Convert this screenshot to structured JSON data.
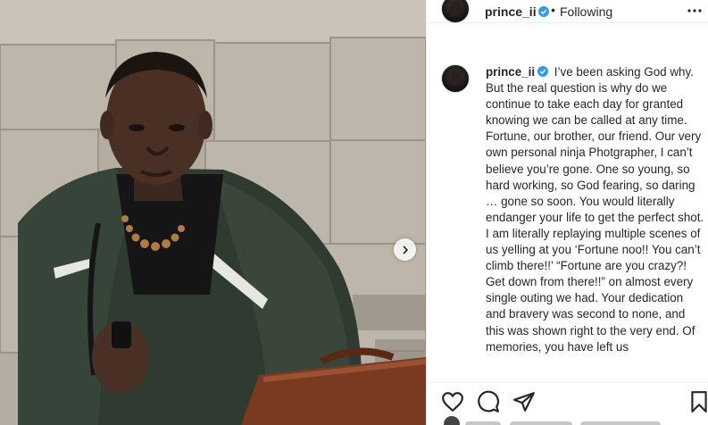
{
  "post": {
    "username": "prince_ii",
    "follow_separator": "•",
    "follow_status": "Following",
    "caption": "I’ve been asking God why. But the real question is why do we continue to take each day for granted knowing we can be called at any time. Fortune, our brother, our friend. Our very own personal ninja Photgrapher, I can’t believe you’re gone. One so young, so hard working, so God fearing, so daring … gone so soon. You would literally endanger your life to get the perfect shot. I am literally replaying multiple scenes of us yelling at you ‘Fortune noo!! You can’t climb there!!’ “Fortune are you crazy?! Get down from there!!” on almost every single outing we had. Your dedication and bravery was second to none, and this was shown right to the very end. Of memories, you have left us"
  },
  "icons": {
    "verified": "verified-badge-icon",
    "more": "more-options-icon",
    "next": "chevron-right-icon",
    "like": "heart-icon",
    "comment": "comment-icon",
    "share": "send-icon",
    "save": "bookmark-icon"
  },
  "colors": {
    "verified_blue": "#3897f0",
    "text": "#262626",
    "border": "#efefef"
  }
}
